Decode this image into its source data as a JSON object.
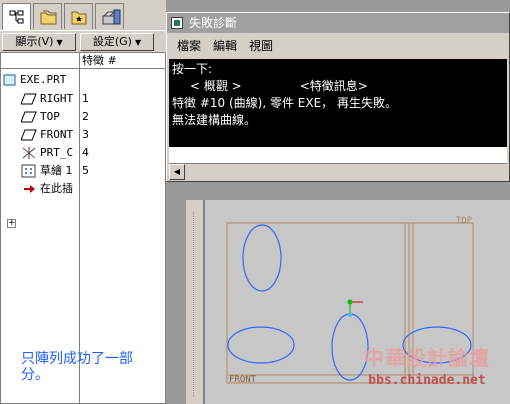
{
  "tabs": [
    {
      "icon": "model-tree-icon",
      "active": true
    },
    {
      "icon": "folder-browser-icon",
      "active": false
    },
    {
      "icon": "favorites-icon",
      "active": false
    },
    {
      "icon": "connections-icon",
      "active": false
    }
  ],
  "toolbar": {
    "show_label": "顯示(V)",
    "settings_label": "設定(G)"
  },
  "tree": {
    "column_header": "特徵 #",
    "items": [
      {
        "label": "EXE.PRT",
        "number": "",
        "icon": "part-icon"
      },
      {
        "label": "RIGHT",
        "number": "1",
        "icon": "datum-plane-icon"
      },
      {
        "label": "TOP",
        "number": "2",
        "icon": "datum-plane-icon"
      },
      {
        "label": "FRONT",
        "number": "3",
        "icon": "datum-plane-icon"
      },
      {
        "label": "PRT_C",
        "number": "4",
        "icon": "coordinate-system-icon"
      },
      {
        "label": "草繪 1",
        "number": "5",
        "icon": "sketch-icon"
      },
      {
        "label": "在此插",
        "number": "",
        "icon": "insert-here-icon"
      }
    ]
  },
  "annotation_note": "只陣列成功了一部分。",
  "dialog": {
    "title": "失敗診斷",
    "menus": [
      "檔案",
      "編輯",
      "視圖"
    ],
    "messages": {
      "line1": "按一下:",
      "overview": "< 概觀 >",
      "feature_info": "<特徵訊息>",
      "line3": "特徵 #10 (曲線), 零件 EXE， 再生失敗。",
      "line4": "無法建構曲線。"
    }
  },
  "canvas_labels": {
    "top": "TOP",
    "front": "FRONT"
  },
  "watermark": {
    "chinese": "中華設計論壇",
    "url": "bbs.chinade.net"
  },
  "colors": {
    "datum": "#c8a068",
    "sketch": "#3366ff",
    "dialog_title": "#a0a0a0",
    "note_text": "#2060ff"
  }
}
